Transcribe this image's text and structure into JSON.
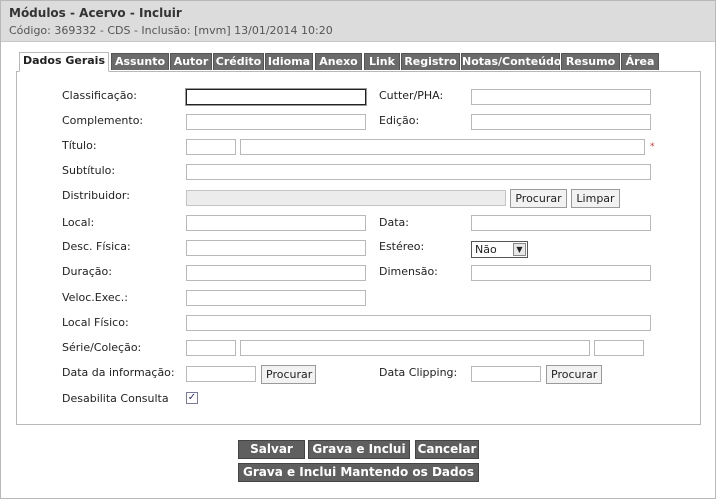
{
  "header": {
    "title": "Módulos - Acervo - Incluir",
    "subtitle": "Código: 369332 - CDS - Inclusão: [mvm] 13/01/2014 10:20"
  },
  "tabs": [
    "Dados Gerais",
    "Assunto",
    "Autor",
    "Crédito",
    "Idioma",
    "Anexo",
    "Link",
    "Registro",
    "Notas/Conteúdo",
    "Resumo",
    "Área"
  ],
  "form": {
    "classificacao": "Classificação:",
    "cutter": "Cutter/PHA:",
    "complemento": "Complemento:",
    "edicao": "Edição:",
    "titulo": "Título:",
    "subtitulo": "Subtítulo:",
    "distribuidor": "Distribuidor:",
    "local": "Local:",
    "data": "Data:",
    "desc_fisica": "Desc. Física:",
    "estereo": "Estéreo:",
    "estereo_value": "Não",
    "duracao": "Duração:",
    "dimensao": "Dimensão:",
    "veloc": "Veloc.Exec.:",
    "local_fisico": "Local Físico:",
    "serie": "Série/Coleção:",
    "data_info": "Data da informação:",
    "data_clipping": "Data Clipping:",
    "desabilita": "Desabilita Consulta",
    "required_mark": "*",
    "check_mark": "✓"
  },
  "buttons": {
    "procurar": "Procurar",
    "limpar": "Limpar",
    "salvar": "Salvar",
    "grava_inclui": "Grava e Inclui",
    "cancelar": "Cancelar",
    "grava_mantendo": "Grava e Inclui Mantendo os Dados"
  }
}
